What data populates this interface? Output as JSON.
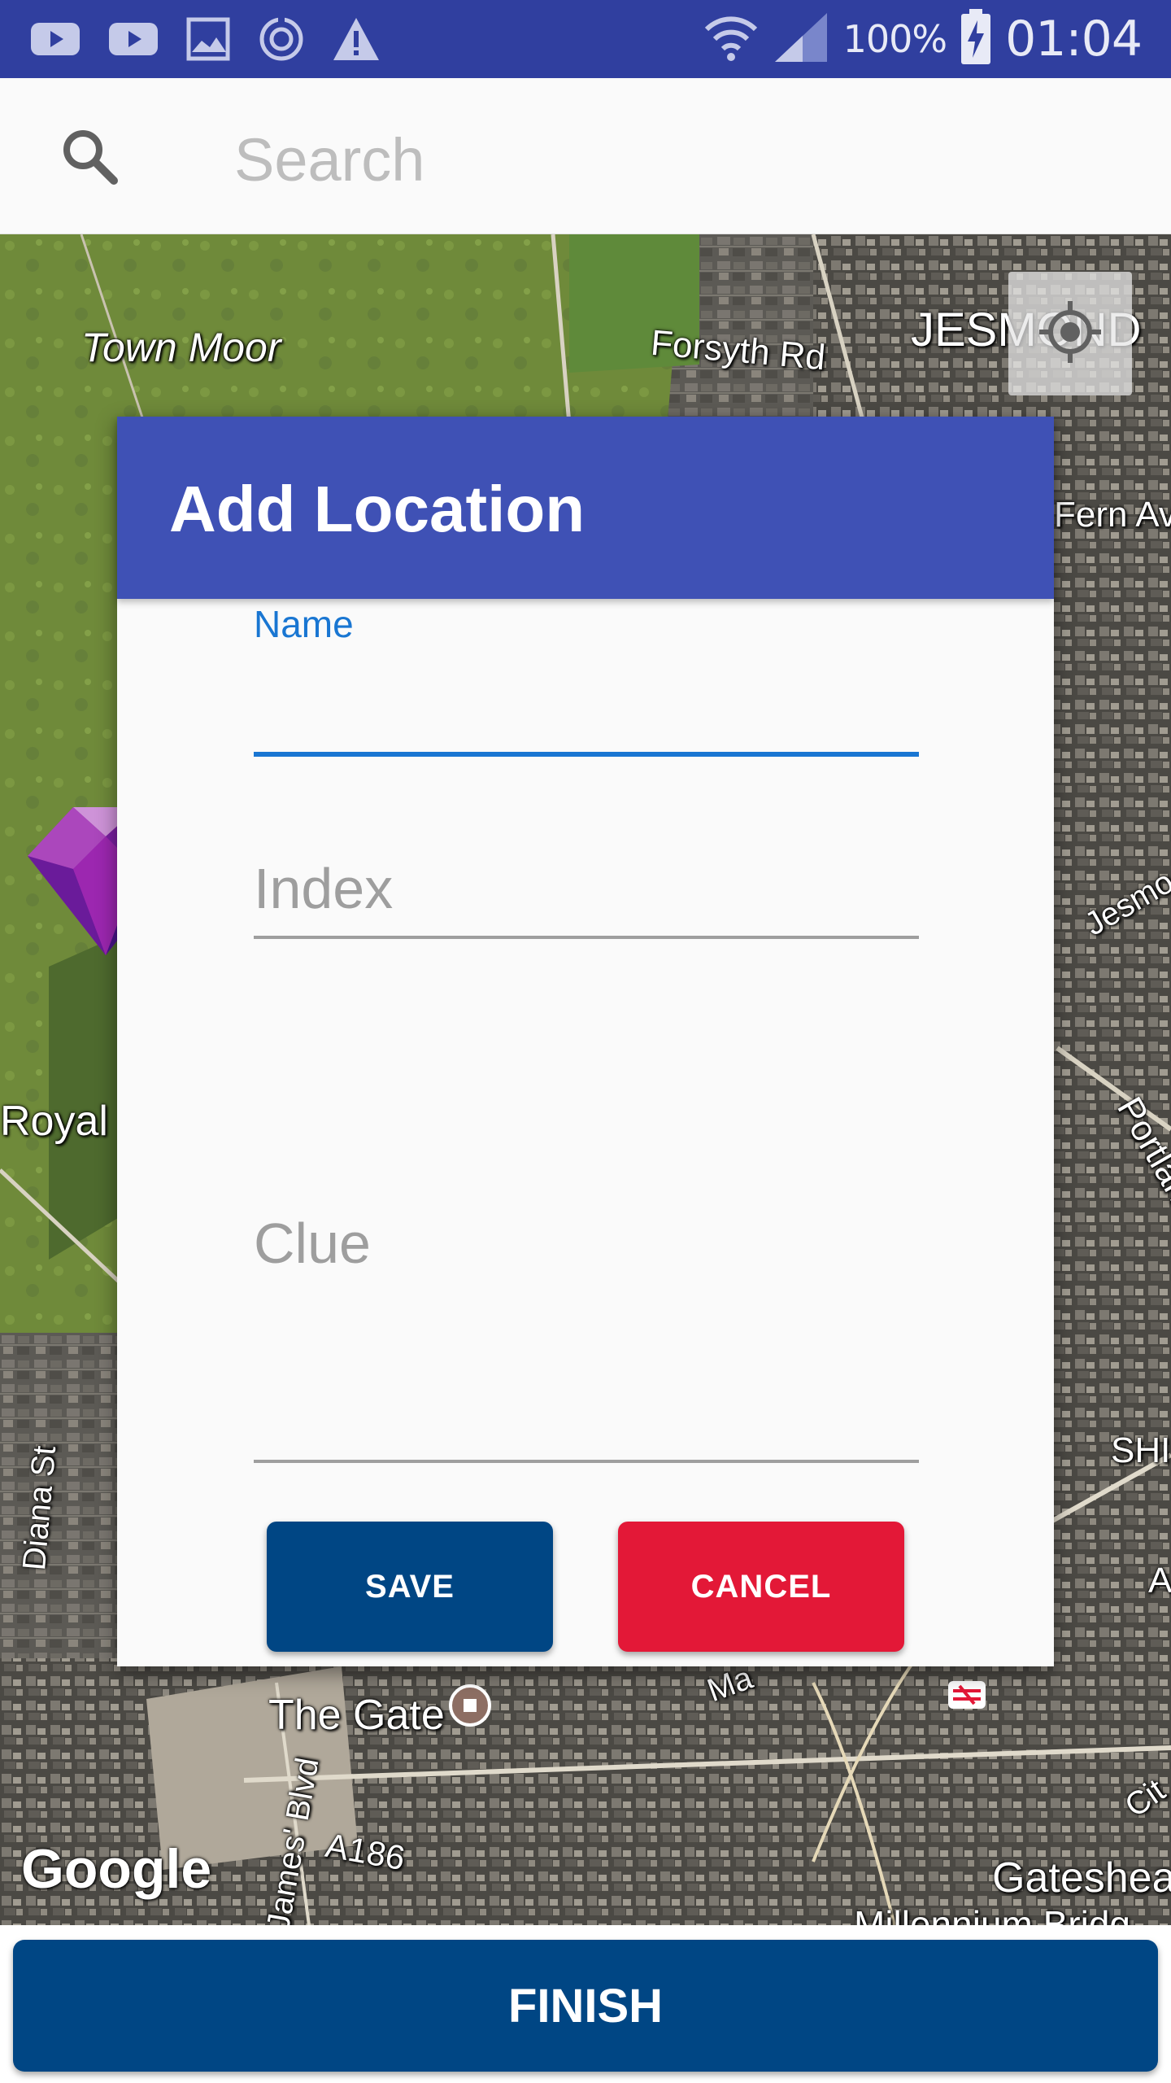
{
  "status_bar": {
    "battery_percent": "100%",
    "time": "01:04",
    "icons": [
      "youtube-icon",
      "youtube-icon",
      "gallery-icon",
      "sync-icon",
      "warning-icon",
      "wifi-icon",
      "signal-icon",
      "battery-charging-icon"
    ]
  },
  "search": {
    "placeholder": "Search",
    "icon": "search-icon"
  },
  "map": {
    "labels": {
      "town_moor": "Town Moor",
      "forsyth_rd": "Forsyth Rd",
      "jesmond": "JESMOND",
      "fern_av": "Fern Av",
      "jesmo": "Jesmo",
      "royal": "Royal V",
      "portland": "Portlan",
      "shi": "SHI",
      "diana_st": "Diana St",
      "the_gate": "The Gate",
      "a186": "A186",
      "james_blvd": "James' Blvd",
      "gateshead": "Gateshea",
      "millennium": "Millennium Bridg",
      "city": "Cit",
      "a": "A",
      "ma": "Ma"
    },
    "attribution": "Google",
    "locate_icon": "my-location-icon",
    "marker_icon": "purple-gem-icon"
  },
  "dialog": {
    "title": "Add Location",
    "fields": {
      "name": {
        "label": "Name",
        "value": ""
      },
      "index": {
        "placeholder": "Index"
      },
      "clue": {
        "placeholder": "Clue"
      }
    },
    "buttons": {
      "save": "SAVE",
      "cancel": "CANCEL"
    }
  },
  "footer": {
    "finish": "FINISH"
  },
  "colors": {
    "status_bar": "#303f9f",
    "dialog_header": "#3f51b5",
    "primary_button": "#004684",
    "cancel_button": "#e31837",
    "active_field": "#1976d2"
  }
}
